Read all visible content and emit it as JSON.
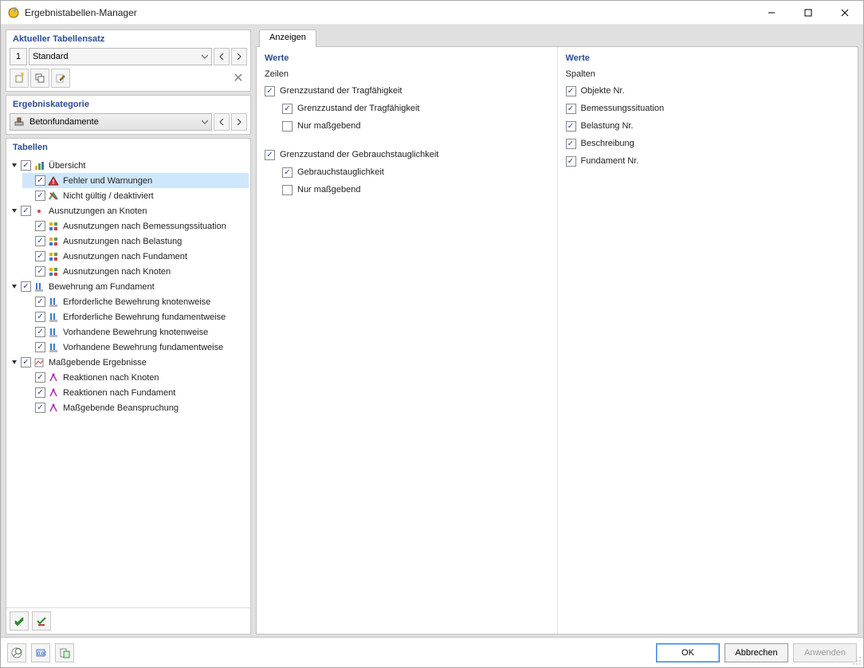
{
  "window": {
    "title": "Ergebnistabellen-Manager"
  },
  "tablesset": {
    "heading": "Aktueller Tabellensatz",
    "number": "1",
    "selected": "Standard"
  },
  "category": {
    "heading": "Ergebniskategorie",
    "selected": "Betonfundamente"
  },
  "tables": {
    "heading": "Tabellen",
    "tree": [
      {
        "label": "Übersicht",
        "expanded": true,
        "checked": true,
        "icon": "overview-icon",
        "children": [
          {
            "label": "Fehler und Warnungen",
            "checked": true,
            "selected": true,
            "icon": "warning-icon"
          },
          {
            "label": "Nicht gültig / deaktiviert",
            "checked": true,
            "icon": "invalid-icon"
          }
        ]
      },
      {
        "label": "Ausnutzungen an Knoten",
        "expanded": true,
        "checked": true,
        "icon": "dot-red-icon",
        "children": [
          {
            "label": "Ausnutzungen nach Bemessungssituation",
            "checked": true,
            "icon": "util-icon"
          },
          {
            "label": "Ausnutzungen nach Belastung",
            "checked": true,
            "icon": "util-icon"
          },
          {
            "label": "Ausnutzungen nach Fundament",
            "checked": true,
            "icon": "util-icon"
          },
          {
            "label": "Ausnutzungen nach Knoten",
            "checked": true,
            "icon": "util-icon"
          }
        ]
      },
      {
        "label": "Bewehrung am Fundament",
        "expanded": true,
        "checked": true,
        "icon": "rebar-icon",
        "children": [
          {
            "label": "Erforderliche Bewehrung knotenweise",
            "checked": true,
            "icon": "rebar-icon"
          },
          {
            "label": "Erforderliche Bewehrung fundamentweise",
            "checked": true,
            "icon": "rebar-icon"
          },
          {
            "label": "Vorhandene Bewehrung knotenweise",
            "checked": true,
            "icon": "rebar-icon"
          },
          {
            "label": "Vorhandene Bewehrung fundamentweise",
            "checked": true,
            "icon": "rebar-icon"
          }
        ]
      },
      {
        "label": "Maßgebende Ergebnisse",
        "expanded": true,
        "checked": true,
        "icon": "gov-icon",
        "children": [
          {
            "label": "Reaktionen nach Knoten",
            "checked": true,
            "icon": "react-icon"
          },
          {
            "label": "Reaktionen nach Fundament",
            "checked": true,
            "icon": "react-icon"
          },
          {
            "label": "Maßgebende Beanspruchung",
            "checked": true,
            "icon": "react-icon"
          }
        ]
      }
    ]
  },
  "tab": {
    "anzeigen": "Anzeigen"
  },
  "werte_left": {
    "heading": "Werte",
    "zeilen_label": "Zeilen",
    "rows": [
      {
        "label": "Grenzzustand der Tragfähigkeit",
        "checked": true,
        "children": [
          {
            "label": "Grenzzustand der Tragfähigkeit",
            "checked": true
          },
          {
            "label": "Nur maßgebend",
            "checked": false
          }
        ]
      },
      {
        "label": "Grenzzustand der Gebrauchstauglichkeit",
        "checked": true,
        "children": [
          {
            "label": "Gebrauchstauglichkeit",
            "checked": true
          },
          {
            "label": "Nur maßgebend",
            "checked": false
          }
        ]
      }
    ]
  },
  "werte_right": {
    "heading": "Werte",
    "spalten_label": "Spalten",
    "cols": [
      {
        "label": "Objekte Nr.",
        "checked": true
      },
      {
        "label": "Bemessungssituation",
        "checked": true
      },
      {
        "label": "Belastung Nr.",
        "checked": true
      },
      {
        "label": "Beschreibung",
        "checked": true
      },
      {
        "label": "Fundament Nr.",
        "checked": true
      }
    ]
  },
  "footer": {
    "ok": "OK",
    "cancel": "Abbrechen",
    "apply": "Anwenden"
  }
}
